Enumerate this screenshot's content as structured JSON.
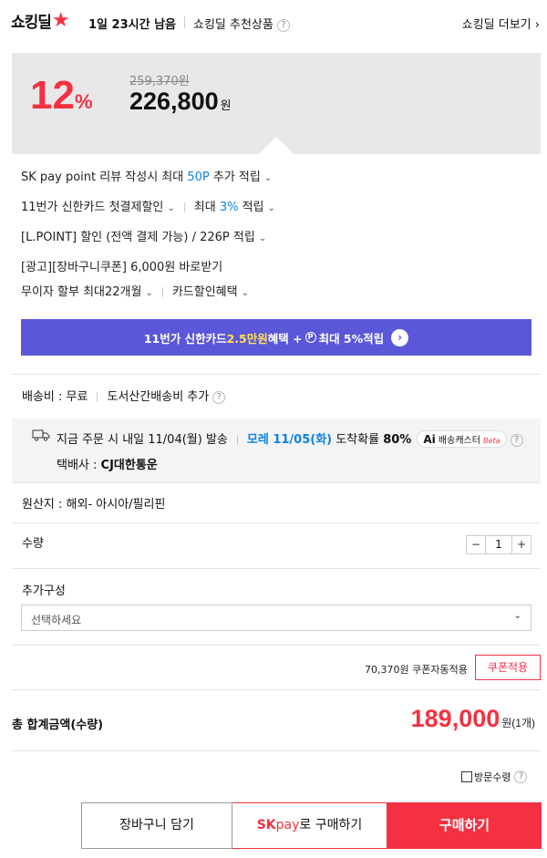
{
  "header": {
    "logo": "쇼킹딜",
    "timer": "1일 23시간 남음",
    "recommend": "쇼킹딜 추천상품",
    "more": "쇼킹딜 더보기"
  },
  "price": {
    "discount": "12",
    "percent": "%",
    "original": "259,370원",
    "sale": "226,800",
    "won": "원"
  },
  "benefits": {
    "skpay": {
      "pre": "SK pay point 리뷰 작성시 최대 ",
      "highlight": "50P",
      "post": " 추가 적립"
    },
    "shinhan": {
      "text": "11번가 신한카드 첫결제할인",
      "max_pre": "최대 ",
      "max_highlight": "3%",
      "max_post": " 적립"
    },
    "lpoint": "[L.POINT] 할인 (전액 결제 가능) / 226P 적립",
    "ad_coupon": "[광고][장바구니쿠폰] 6,000원 바로받기",
    "installment": "무이자 할부 최대22개월",
    "card_benefit": "카드할인혜택"
  },
  "banner": {
    "pre": "11번가 신한카드 ",
    "highlight": "2.5만원",
    "mid": " 혜택 + ",
    "p": "P",
    "post": " 최대 5%적립",
    "go": "›"
  },
  "shipping": {
    "fee": "배송비 : 무료",
    "extra": "도서산간배송비 추가",
    "order_text": "지금 주문 시 내일 11/04(월) 발송",
    "arrival": "모레 11/05(화)",
    "arrival_post": " 도착확률 ",
    "prob": "80%",
    "ai": "Ai",
    "ai_text": "배송캐스터",
    "beta": "Beta",
    "courier_label": "택배사 : ",
    "courier": "CJ대한통운"
  },
  "origin": "원산지 : 해외- 아시아/필리핀",
  "quantity": {
    "label": "수량",
    "minus": "−",
    "value": "1",
    "plus": "+"
  },
  "addon": {
    "label": "추가구성",
    "placeholder": "선택하세요"
  },
  "coupon": {
    "text": "70,370원 쿠폰자동적용",
    "button": "쿠폰적용"
  },
  "total": {
    "label": "총 합계금액(수량)",
    "amount": "189,000",
    "unit": "원(1개)"
  },
  "visit": "방문수령",
  "buttons": {
    "cart": "장바구니 담기",
    "sk": "SK",
    "pay": "pay",
    "sk_post": "로 구매하기",
    "buy": "구매하기"
  },
  "colors": {
    "accent": "#f43142",
    "blue": "#0b83e6",
    "banner": "#5b57d9"
  }
}
